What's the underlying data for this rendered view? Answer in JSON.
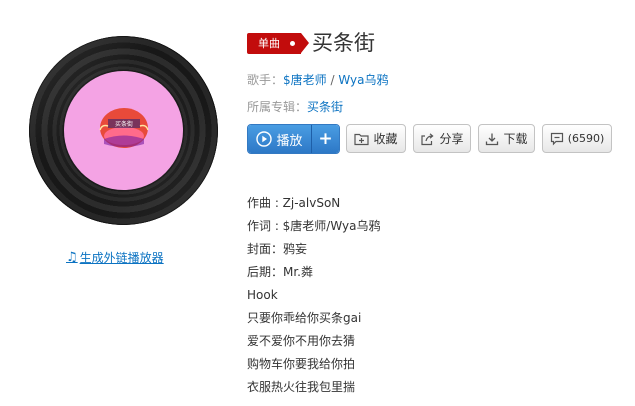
{
  "header": {
    "badge": "单曲",
    "title": "买条街"
  },
  "meta": {
    "artist_label": "歌手：",
    "artists": [
      "$唐老师",
      "Wya乌鸦"
    ],
    "artist_separator": " / ",
    "album_label": "所属专辑：",
    "album": "买条街"
  },
  "cover": {
    "label_color": "#f4a3e4",
    "label_art_text": "买条街"
  },
  "generate_link": "生成外链播放器",
  "actions": {
    "play": "播放",
    "add": "+",
    "favorite": "收藏",
    "share": "分享",
    "download": "下载",
    "comment_count": "(6590)"
  },
  "lyrics": [
    "作曲 : Zj-alvSoN",
    "作词 : $唐老师/Wya乌鸦",
    "封面：鸦妄",
    "后期：Mr.粦",
    "Hook",
    "只要你乖给你买条gai",
    "爱不爱你不用你去猜",
    "购物车你要我给你拍",
    "衣服热火往我包里揣"
  ],
  "colors": {
    "brand_red": "#c20c0c",
    "link_blue": "#0c73c2",
    "play_blue": "#2d78c6"
  }
}
